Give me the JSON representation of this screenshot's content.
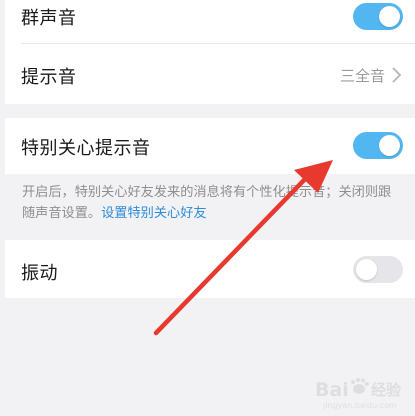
{
  "settings": {
    "group_sound": {
      "label": "群声音",
      "enabled": true
    },
    "notification_sound": {
      "label": "提示音",
      "value": "三全音"
    },
    "special_care_sound": {
      "label": "特别关心提示音",
      "enabled": true
    },
    "description": {
      "text": "开启后，特别关心好友发来的消息将有个性化提示音；关闭则跟随声音设置。",
      "link": "设置特别关心好友"
    },
    "vibration": {
      "label": "振动",
      "enabled": false
    }
  },
  "annotation": {
    "color": "#e8392e"
  },
  "watermark": {
    "brand": "Bai",
    "brand_suffix": "经验",
    "site": "jingyan.baidu.com"
  },
  "colors": {
    "toggle_on": "#52b7f0",
    "toggle_off": "#e6e6ea",
    "link": "#2f8cdb"
  }
}
